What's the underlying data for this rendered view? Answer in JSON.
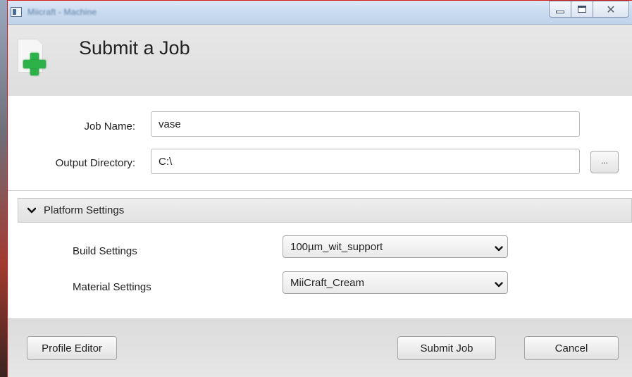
{
  "window": {
    "title": "Miicraft - Machine"
  },
  "header": {
    "title": "Submit a Job",
    "icon": "document-add-icon"
  },
  "form": {
    "job_name_label": "Job Name:",
    "job_name_value": "vase",
    "output_dir_label": "Output Directory:",
    "output_dir_value": "C:\\",
    "browse_label": "..."
  },
  "platform": {
    "expander_label": "Platform Settings",
    "expanded": true,
    "build_label": "Build Settings",
    "build_value": "100µm_wit_support",
    "material_label": "Material Settings",
    "material_value": "MiiCraft_Cream"
  },
  "footer": {
    "profile_editor_label": "Profile Editor",
    "submit_label": "Submit Job",
    "cancel_label": "Cancel"
  },
  "colors": {
    "accent_plus": "#2db24a",
    "header_bg": "#e2e2e2",
    "window_border": "#d21c1c"
  }
}
